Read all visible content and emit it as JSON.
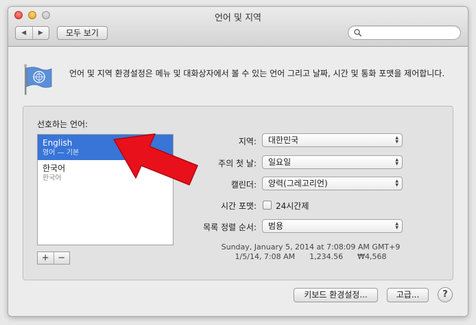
{
  "window": {
    "title": "언어 및 지역"
  },
  "toolbar": {
    "back_glyph": "◀",
    "forward_glyph": "▶",
    "show_all_label": "모두 보기",
    "search": {
      "value": "",
      "placeholder": ""
    }
  },
  "description": "언어 및 지역 환경설정은 메뉴 및 대화상자에서 볼 수 있는 언어 그리고 날짜, 시간 및 통화 포맷을 제어합니다.",
  "preferred_languages": {
    "label": "선호하는 언어:",
    "items": [
      {
        "name": "English",
        "sub": "영어 — 기본",
        "selected": true
      },
      {
        "name": "한국어",
        "sub": "한국어",
        "selected": false
      }
    ],
    "add_label": "+",
    "remove_label": "−"
  },
  "settings": {
    "region": {
      "label": "지역:",
      "value": "대한민국"
    },
    "first_day": {
      "label": "주의 첫 날:",
      "value": "일요일"
    },
    "calendar": {
      "label": "캘린더:",
      "value": "양력(그레고리언)"
    },
    "time_format": {
      "label": "시간 포맷:",
      "checkbox_label": "24시간제",
      "checked": false
    },
    "list_sort": {
      "label": "목록 정렬 순서:",
      "value": "범용"
    }
  },
  "sample": {
    "line1": "Sunday, January 5, 2014 at 7:08:09 AM GMT+9",
    "line2": "1/5/14, 7:08 AM      1,234.56      ₩4,568"
  },
  "buttons": {
    "keyboard_prefs": "키보드 환경설정...",
    "advanced": "고급...",
    "help": "?"
  },
  "colors": {
    "selection": "#3875d7",
    "arrow": "#e8101b"
  }
}
